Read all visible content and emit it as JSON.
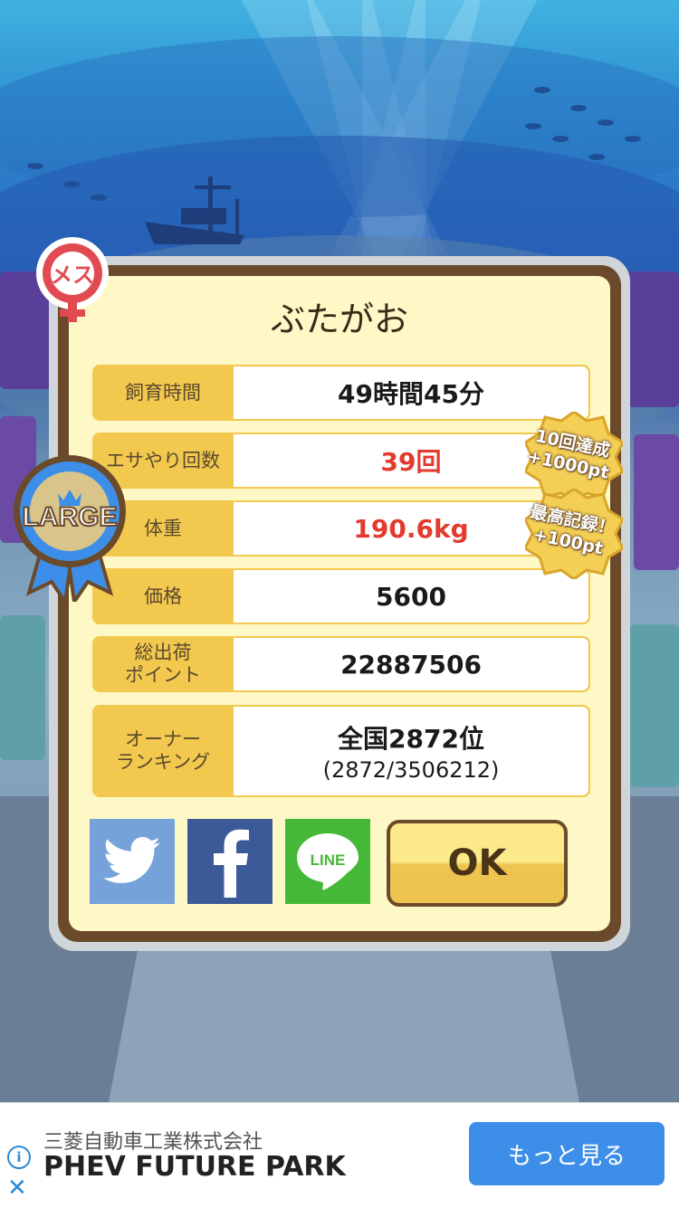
{
  "pig_name": "ぶたがお",
  "gender_badge": "メス",
  "size_ribbon": "LARGE",
  "stats": [
    {
      "label": "飼育時間",
      "value": "49時間45分",
      "highlight": false
    },
    {
      "label": "エサやり回数",
      "value": "39回",
      "highlight": true
    },
    {
      "label": "体重",
      "value": "190.6kg",
      "highlight": true
    },
    {
      "label": "価格",
      "value": "5600",
      "highlight": false
    },
    {
      "label": "総出荷\nポイント",
      "value": "22887506",
      "highlight": false
    },
    {
      "label": "オーナー\nランキング",
      "value": "全国2872位",
      "sub": "(2872/3506212)",
      "highlight": false
    }
  ],
  "bonus_seals": [
    {
      "line1": "10回達成",
      "line2": "+1000pt"
    },
    {
      "line1": "最高記録！",
      "line2": "+100pt"
    }
  ],
  "share": {
    "twitter_icon": "twitter-bird-icon",
    "facebook_icon": "facebook-f-icon",
    "line_label": "LINE"
  },
  "ok_label": "OK",
  "ad": {
    "company": "三菱自動車工業株式会社",
    "title": "PHEV FUTURE PARK",
    "button": "もっと見る",
    "info_icon": "i",
    "close_icon": "✕"
  },
  "colors": {
    "highlight_red": "#e33a2e",
    "label_gold": "#f3c84e",
    "frame_brown": "#6b4a2c"
  }
}
